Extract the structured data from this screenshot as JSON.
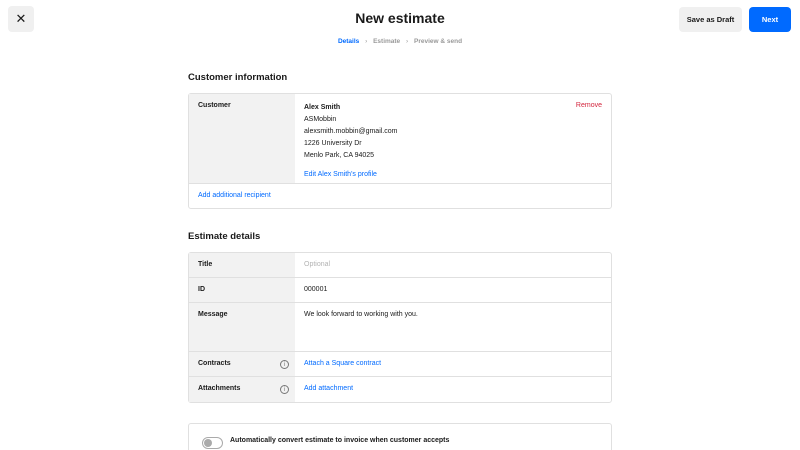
{
  "header": {
    "close_glyph": "✕",
    "title": "New estimate",
    "save_draft_label": "Save as Draft",
    "next_label": "Next"
  },
  "breadcrumb": {
    "steps": [
      "Details",
      "Estimate",
      "Preview & send"
    ],
    "separator": "›"
  },
  "customer_section": {
    "title": "Customer information",
    "label": "Customer",
    "name": "Alex Smith",
    "company": "ASMobbin",
    "email": "alexsmith.mobbin@gmail.com",
    "address_line1": "1226 University Dr",
    "address_line2": "Menlo Park, CA 94025",
    "edit_profile_link": "Edit Alex Smith's profile",
    "remove_link": "Remove",
    "add_recipient_link": "Add additional recipient"
  },
  "estimate_section": {
    "title": "Estimate details",
    "title_label": "Title",
    "title_placeholder": "Optional",
    "id_label": "ID",
    "id_value": "000001",
    "message_label": "Message",
    "message_value": "We look forward to working with you.",
    "contracts_label": "Contracts",
    "contracts_link": "Attach a Square contract",
    "attachments_label": "Attachments",
    "attachments_link": "Add attachment",
    "info_glyph": "i"
  },
  "auto_convert": {
    "label": "Automatically convert estimate to invoice when customer accepts",
    "enabled": false
  },
  "colors": {
    "accent": "#006aff",
    "remove": "#d3243c",
    "label_bg": "#f2f2f2"
  }
}
